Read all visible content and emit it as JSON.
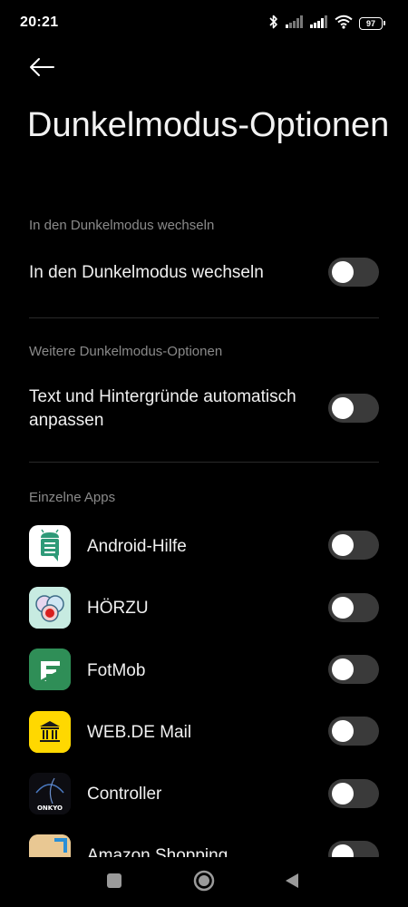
{
  "status_bar": {
    "time": "20:21",
    "battery": "97",
    "icons": [
      "bluetooth-icon",
      "signal-icon",
      "signal-icon",
      "wifi-icon",
      "battery-icon"
    ]
  },
  "header": {
    "back_icon": "arrow-left-icon",
    "title": "Dunkelmodus-Optionen"
  },
  "sections": {
    "dark_mode": {
      "header": "In den Dunkelmodus wechseln",
      "item_label": "In den Dunkelmodus wechseln",
      "enabled": false
    },
    "more_options": {
      "header": "Weitere Dunkelmodus-Optionen",
      "item_label": "Text und Hintergründe automatisch anpassen",
      "enabled": false
    },
    "apps": {
      "header": "Einzelne Apps",
      "items": [
        {
          "label": "Android-Hilfe",
          "enabled": false
        },
        {
          "label": "HÖRZU",
          "enabled": false
        },
        {
          "label": "FotMob",
          "enabled": false
        },
        {
          "label": "WEB.DE Mail",
          "enabled": false
        },
        {
          "label": "Controller",
          "icon_text": "ONKYO",
          "enabled": false
        },
        {
          "label": "Amazon Shopping",
          "enabled": false
        }
      ]
    }
  },
  "colors": {
    "background": "#000000",
    "toggle_off": "#3a3a3a",
    "secondary_text": "#8a8a8a"
  },
  "nav_bar": {
    "icons": [
      "recents-square-icon",
      "home-circle-icon",
      "back-triangle-icon"
    ]
  }
}
